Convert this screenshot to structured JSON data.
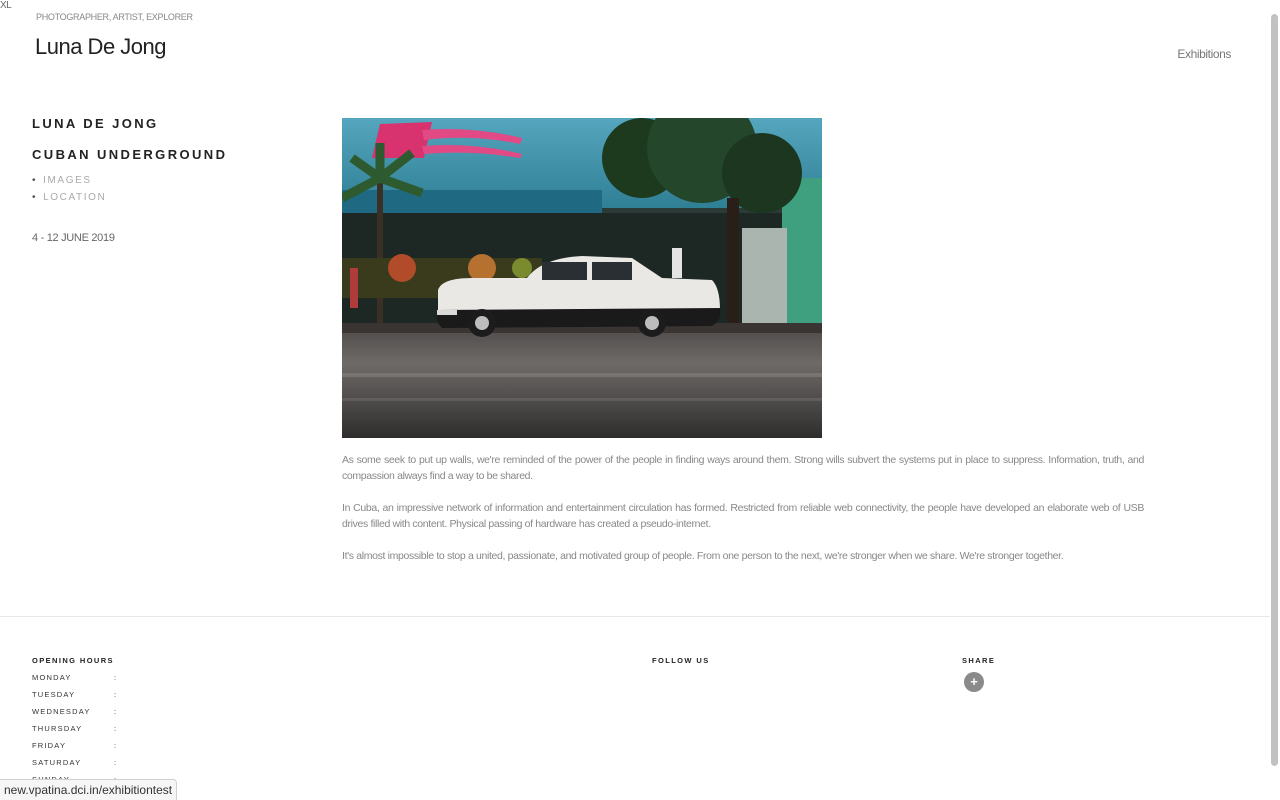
{
  "debug_label": "XL",
  "header": {
    "tagline": "PHOTOGRAPHER, ARTIST, EXPLORER",
    "brand": "Luna De Jong",
    "nav": [
      {
        "label": "Exhibitions"
      }
    ]
  },
  "exhibition": {
    "artist": "LUNA DE JONG",
    "title": "CUBAN UNDERGROUND",
    "sublinks": [
      {
        "label": "IMAGES"
      },
      {
        "label": "LOCATION"
      }
    ],
    "dates": "4 - 12 JUNE 2019",
    "paragraphs": [
      "As some seek to put up walls, we're reminded of the power of the people in finding ways around them. Strong wills subvert the systems put in place to suppress. Information, truth, and compassion always find a way to be shared.",
      "In Cuba, an impressive network of information and entertainment circulation has formed. Restricted from reliable web connectivity, the people have developed an elaborate web of USB drives filled with content. Physical passing of hardware has created a pseudo-internet.",
      "It's almost impossible to stop a united, passionate, and motivated group of people. From one person to the next, we're stronger when we share. We're stronger together."
    ]
  },
  "footer": {
    "opening_hours": {
      "heading": "OPENING HOURS",
      "rows": [
        {
          "day": "MONDAY",
          "sep": ":"
        },
        {
          "day": "TUESDAY",
          "sep": ":"
        },
        {
          "day": "WEDNESDAY",
          "sep": ":"
        },
        {
          "day": "THURSDAY",
          "sep": ":"
        },
        {
          "day": "FRIDAY",
          "sep": ":"
        },
        {
          "day": "SATURDAY",
          "sep": ":"
        },
        {
          "day": "SUNDAY",
          "sep": ":"
        }
      ]
    },
    "follow_us": {
      "heading": "FOLLOW US"
    },
    "share": {
      "heading": "SHARE",
      "button_symbol": "+"
    }
  },
  "status_bar": {
    "url": "new.vpatina.dci.in/exhibitiontest"
  },
  "colors": {
    "page_bg": "#ffffff",
    "heading_text": "#222222",
    "body_text": "#888888",
    "share_button": "#8a8a8a"
  }
}
